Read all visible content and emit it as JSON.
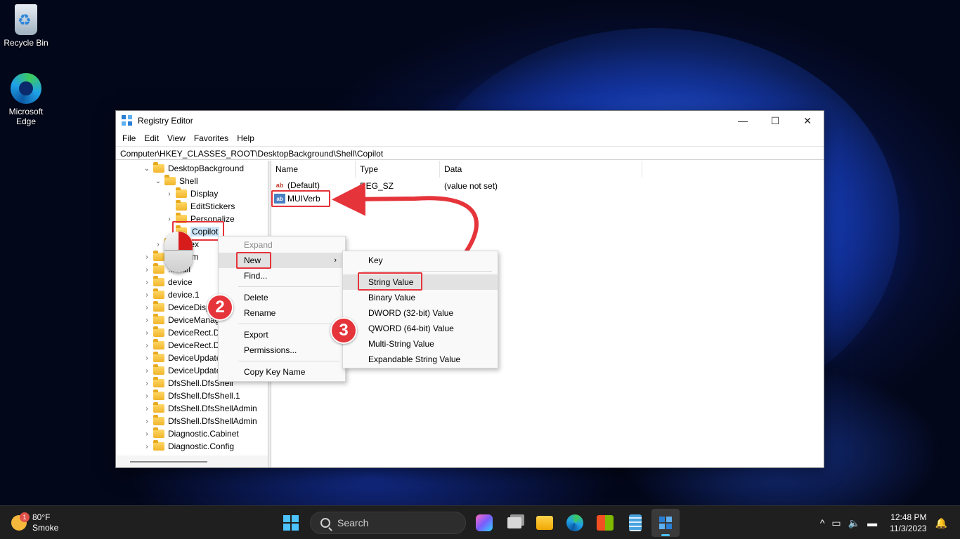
{
  "desktop": {
    "recycle_bin": "Recycle Bin",
    "edge": "Microsoft\nEdge"
  },
  "window": {
    "title": "Registry Editor",
    "controls": {
      "minimize": "—",
      "maximize": "☐",
      "close": "✕"
    },
    "menu": [
      "File",
      "Edit",
      "View",
      "Favorites",
      "Help"
    ],
    "address": "Computer\\HKEY_CLASSES_ROOT\\DesktopBackground\\Shell\\Copilot"
  },
  "tree": {
    "items": [
      {
        "label": "DesktopBackground",
        "chevron": "⌄"
      },
      {
        "label": "Shell",
        "chevron": "⌄"
      },
      {
        "label": "Display",
        "chevron": "›"
      },
      {
        "label": "EditStickers",
        "chevron": ""
      },
      {
        "label": "Personalize",
        "chevron": "›"
      },
      {
        "label": "Copilot",
        "chevron": ""
      },
      {
        "label": "...llex",
        "chevron": "›"
      },
      {
        "label": "...pthem",
        "chevron": "›"
      },
      {
        "label": "...etail",
        "chevron": "›"
      },
      {
        "label": "device",
        "chevron": "›"
      },
      {
        "label": "device.1",
        "chevron": "›"
      },
      {
        "label": "DeviceDisp",
        "chevron": "›"
      },
      {
        "label": "DeviceManag",
        "chevron": "›"
      },
      {
        "label": "DeviceRect.De",
        "chevron": "›"
      },
      {
        "label": "DeviceRect.De",
        "chevron": "›"
      },
      {
        "label": "DeviceUpdate",
        "chevron": "›"
      },
      {
        "label": "DeviceUpdate",
        "chevron": "›"
      },
      {
        "label": "DfsShell.DfsShell",
        "chevron": "›"
      },
      {
        "label": "DfsShell.DfsShell.1",
        "chevron": "›"
      },
      {
        "label": "DfsShell.DfsShellAdmin",
        "chevron": "›"
      },
      {
        "label": "DfsShell.DfsShellAdmin",
        "chevron": "›"
      },
      {
        "label": "Diagnostic.Cabinet",
        "chevron": "›"
      },
      {
        "label": "Diagnostic.Config",
        "chevron": "›"
      }
    ]
  },
  "values": {
    "columns": [
      "Name",
      "Type",
      "Data"
    ],
    "rows": [
      {
        "icon": "ab",
        "name": "(Default)",
        "type": "REG_SZ",
        "data": "(value not set)"
      },
      {
        "icon": "ab",
        "name": "MUIVerb",
        "type": "",
        "data": ""
      }
    ]
  },
  "context_menu": {
    "items": [
      "Expand",
      "New",
      "Find...",
      "Delete",
      "Rename",
      "Export",
      "Permissions...",
      "Copy Key Name"
    ],
    "submenu_arrow": "›"
  },
  "submenu": {
    "items": [
      "Key",
      "String Value",
      "Binary Value",
      "DWORD (32-bit) Value",
      "QWORD (64-bit) Value",
      "Multi-String Value",
      "Expandable String Value"
    ]
  },
  "steps": [
    "2",
    "3"
  ],
  "colors": {
    "annotation_red": "#e5343a",
    "selection": "#cce4f7",
    "taskbar": "#1f1f1f"
  },
  "taskbar": {
    "weather": {
      "temp": "80°F",
      "condition": "Smoke",
      "badge": "1"
    },
    "search_placeholder": "Search",
    "pinned": [
      "windows-start-icon",
      "search-icon",
      "copilot-icon",
      "task-view-icon",
      "file-explorer-icon",
      "edge-icon",
      "store-icon",
      "notepad-icon",
      "registry-editor-icon"
    ],
    "tray": {
      "chevron": "^",
      "time": "12:48 PM",
      "date": "11/3/2023"
    }
  }
}
